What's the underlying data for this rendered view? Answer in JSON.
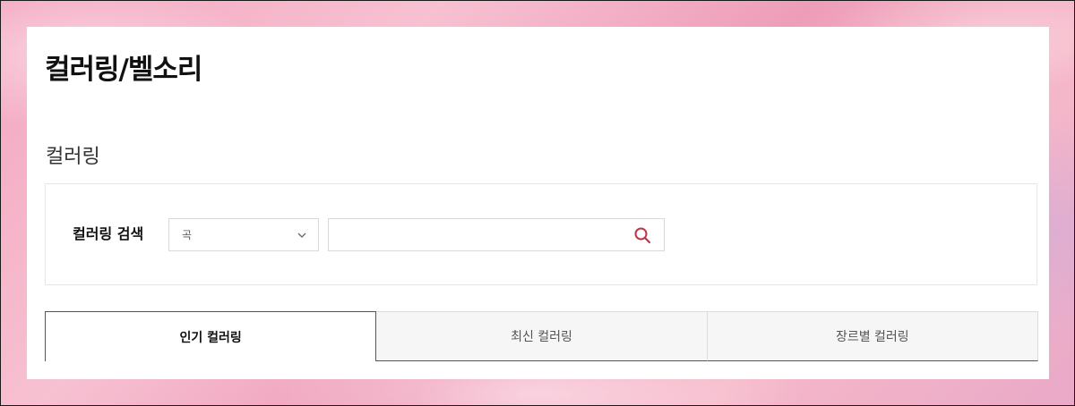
{
  "page": {
    "title": "컬러링/벨소리",
    "section_title": "컬러링"
  },
  "search": {
    "label": "컬러링 검색",
    "select_value": "곡",
    "input_value": "",
    "input_placeholder": "",
    "search_icon": "search-icon",
    "accent_color": "#c0344a"
  },
  "tabs": [
    {
      "label": "인기 컬러링",
      "active": true
    },
    {
      "label": "최신 컬러링",
      "active": false
    },
    {
      "label": "장르별 컬러링",
      "active": false
    }
  ]
}
